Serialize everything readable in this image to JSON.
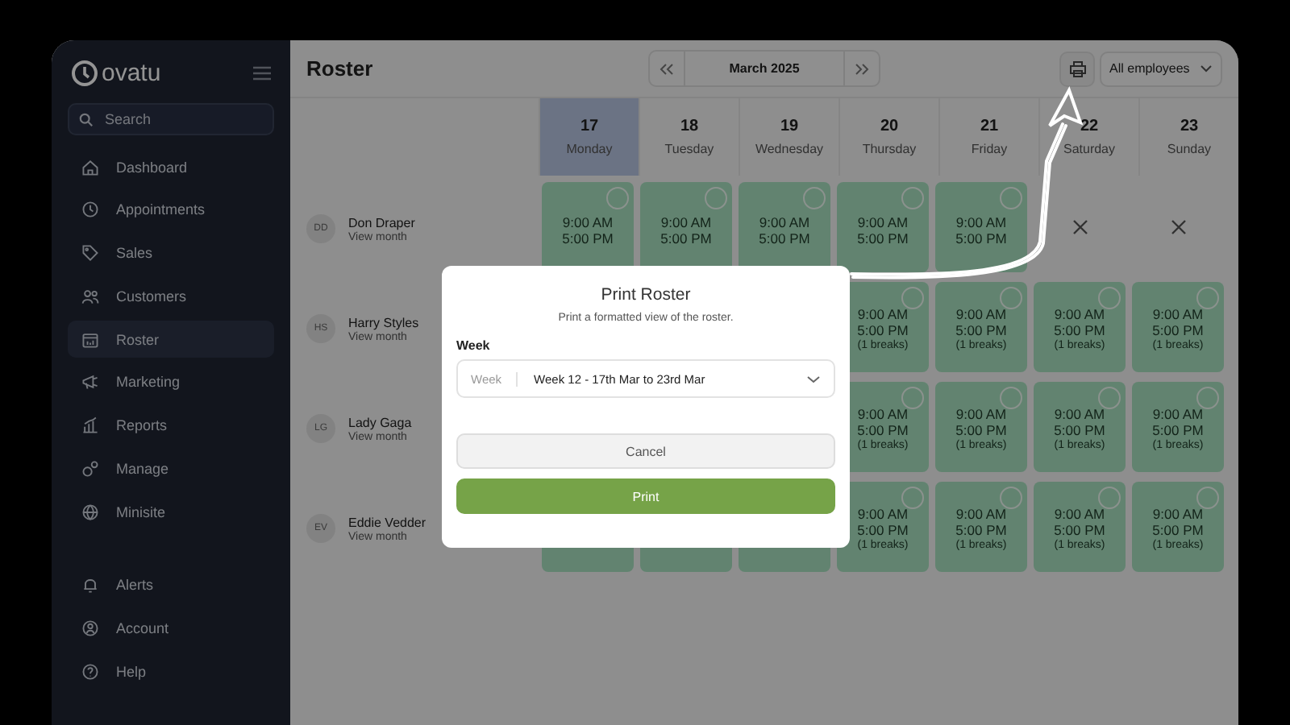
{
  "sidebar": {
    "logo": "ovatu",
    "search": {
      "placeholder": "Search"
    },
    "items": [
      {
        "label": "Dashboard",
        "selected": false
      },
      {
        "label": "Appointments",
        "selected": false
      },
      {
        "label": "Sales",
        "selected": false
      },
      {
        "label": "Customers",
        "selected": false
      },
      {
        "label": "Roster",
        "selected": true
      },
      {
        "label": "Marketing",
        "selected": false
      },
      {
        "label": "Reports",
        "selected": false
      },
      {
        "label": "Manage",
        "selected": false
      },
      {
        "label": "Minisite",
        "selected": false
      }
    ],
    "bottom_items": [
      {
        "label": "Alerts"
      },
      {
        "label": "Account"
      },
      {
        "label": "Help"
      }
    ]
  },
  "header": {
    "title": "Roster",
    "month": "March 2025",
    "filter": "All employees"
  },
  "days": [
    {
      "date": "17",
      "weekday": "Monday",
      "selected": true
    },
    {
      "date": "18",
      "weekday": "Tuesday",
      "selected": false
    },
    {
      "date": "19",
      "weekday": "Wednesday",
      "selected": false
    },
    {
      "date": "20",
      "weekday": "Thursday",
      "selected": false
    },
    {
      "date": "21",
      "weekday": "Friday",
      "selected": false
    },
    {
      "date": "22",
      "weekday": "Saturday",
      "selected": false
    },
    {
      "date": "23",
      "weekday": "Sunday",
      "selected": false
    }
  ],
  "staff": [
    {
      "initials": "DD",
      "name": "Don Draper",
      "link": "View month",
      "shifts": [
        {
          "kind": "shift",
          "start": "9:00 AM",
          "end": "5:00 PM"
        },
        {
          "kind": "shift",
          "start": "9:00 AM",
          "end": "5:00 PM"
        },
        {
          "kind": "shift",
          "start": "9:00 AM",
          "end": "5:00 PM"
        },
        {
          "kind": "shift",
          "start": "9:00 AM",
          "end": "5:00 PM"
        },
        {
          "kind": "shift",
          "start": "9:00 AM",
          "end": "5:00 PM"
        },
        {
          "kind": "off"
        },
        {
          "kind": "off"
        }
      ]
    },
    {
      "initials": "HS",
      "name": "Harry Styles",
      "link": "View month",
      "shifts": [
        {
          "kind": "hidden"
        },
        {
          "kind": "hidden"
        },
        {
          "kind": "hidden"
        },
        {
          "kind": "shift",
          "start": "9:00 AM",
          "end": "5:00 PM",
          "breaks": "(1 breaks)"
        },
        {
          "kind": "shift",
          "start": "9:00 AM",
          "end": "5:00 PM",
          "breaks": "(1 breaks)"
        },
        {
          "kind": "shift",
          "start": "9:00 AM",
          "end": "5:00 PM",
          "breaks": "(1 breaks)"
        },
        {
          "kind": "shift",
          "start": "9:00 AM",
          "end": "5:00 PM",
          "breaks": "(1 breaks)"
        }
      ]
    },
    {
      "initials": "LG",
      "name": "Lady Gaga",
      "link": "View month",
      "shifts": [
        {
          "kind": "hidden"
        },
        {
          "kind": "hidden"
        },
        {
          "kind": "hidden"
        },
        {
          "kind": "shift",
          "start": "9:00 AM",
          "end": "5:00 PM",
          "breaks": "(1 breaks)"
        },
        {
          "kind": "shift",
          "start": "9:00 AM",
          "end": "5:00 PM",
          "breaks": "(1 breaks)"
        },
        {
          "kind": "shift",
          "start": "9:00 AM",
          "end": "5:00 PM",
          "breaks": "(1 breaks)"
        },
        {
          "kind": "shift",
          "start": "9:00 AM",
          "end": "5:00 PM",
          "breaks": "(1 breaks)"
        }
      ]
    },
    {
      "initials": "EV",
      "name": "Eddie Vedder",
      "link": "View month",
      "shifts": [
        {
          "kind": "covered"
        },
        {
          "kind": "covered"
        },
        {
          "kind": "covered"
        },
        {
          "kind": "shift",
          "start": "9:00 AM",
          "end": "5:00 PM",
          "breaks": "(1 breaks)"
        },
        {
          "kind": "shift",
          "start": "9:00 AM",
          "end": "5:00 PM",
          "breaks": "(1 breaks)"
        },
        {
          "kind": "shift",
          "start": "9:00 AM",
          "end": "5:00 PM",
          "breaks": "(1 breaks)"
        },
        {
          "kind": "shift",
          "start": "9:00 AM",
          "end": "5:00 PM",
          "breaks": "(1 breaks)"
        }
      ]
    }
  ],
  "dialog": {
    "title": "Print Roster",
    "subtitle": "Print a formatted view of the roster.",
    "field_label": "Week",
    "select_prefix": "Week",
    "select_value": "Week 12 - 17th Mar to 23rd Mar",
    "buttons": [
      {
        "label": "Cancel",
        "kind": "secondary"
      },
      {
        "label": "Print",
        "kind": "primary"
      }
    ]
  }
}
